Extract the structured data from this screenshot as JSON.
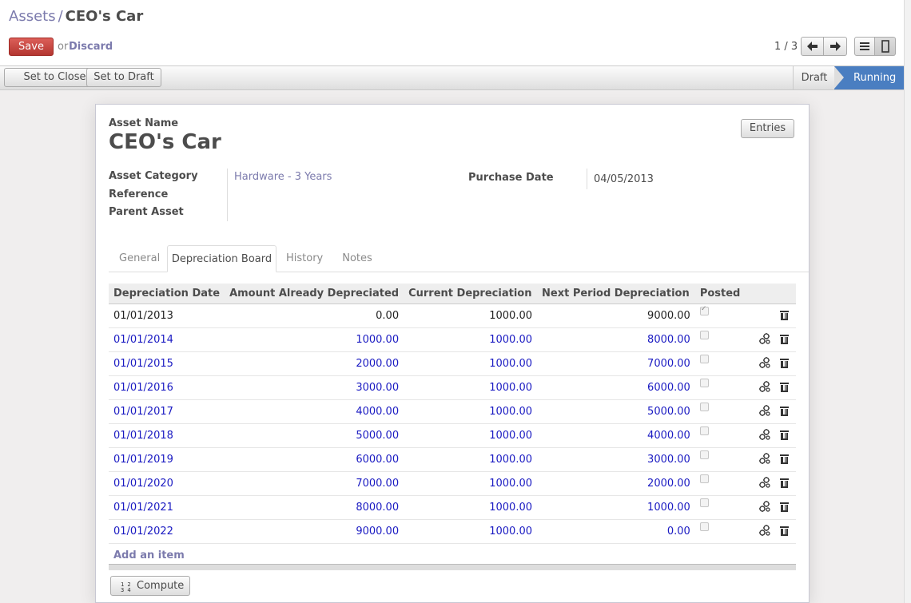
{
  "breadcrumb": {
    "parent": "Assets",
    "separator": "/",
    "current": "CEO's Car"
  },
  "actions": {
    "save": "Save",
    "or": "or",
    "discard": "Discard"
  },
  "pager": {
    "text": "1 / 3",
    "prev_icon": "arrow-left-icon",
    "next_icon": "arrow-right-icon"
  },
  "views": {
    "list_icon": "list-view-icon",
    "form_icon": "form-view-icon",
    "active": "form"
  },
  "statusbar": {
    "buttons": [
      "Set to Close",
      "Set to Draft"
    ],
    "stages": [
      "Draft",
      "Running"
    ],
    "current_stage": "Running"
  },
  "form": {
    "asset_name_label": "Asset Name",
    "asset_name": "CEO's Car",
    "entries_button": "Entries",
    "category_label": "Asset Category",
    "category_value": "Hardware - 3 Years",
    "reference_label": "Reference",
    "parent_label": "Parent Asset",
    "purchase_date_label": "Purchase Date",
    "purchase_date_value": "04/05/2013"
  },
  "tabs": [
    "General",
    "Depreciation Board",
    "History",
    "Notes"
  ],
  "active_tab": "Depreciation Board",
  "board": {
    "columns": [
      "Depreciation Date",
      "Amount Already Depreciated",
      "Current Depreciation",
      "Next Period Depreciation",
      "Posted"
    ],
    "rows": [
      {
        "date": "01/01/2013",
        "already": "0.00",
        "current": "1000.00",
        "next": "9000.00",
        "posted": true
      },
      {
        "date": "01/01/2014",
        "already": "1000.00",
        "current": "1000.00",
        "next": "8000.00",
        "posted": false
      },
      {
        "date": "01/01/2015",
        "already": "2000.00",
        "current": "1000.00",
        "next": "7000.00",
        "posted": false
      },
      {
        "date": "01/01/2016",
        "already": "3000.00",
        "current": "1000.00",
        "next": "6000.00",
        "posted": false
      },
      {
        "date": "01/01/2017",
        "already": "4000.00",
        "current": "1000.00",
        "next": "5000.00",
        "posted": false
      },
      {
        "date": "01/01/2018",
        "already": "5000.00",
        "current": "1000.00",
        "next": "4000.00",
        "posted": false
      },
      {
        "date": "01/01/2019",
        "already": "6000.00",
        "current": "1000.00",
        "next": "3000.00",
        "posted": false
      },
      {
        "date": "01/01/2020",
        "already": "7000.00",
        "current": "1000.00",
        "next": "2000.00",
        "posted": false
      },
      {
        "date": "01/01/2021",
        "already": "8000.00",
        "current": "1000.00",
        "next": "1000.00",
        "posted": false
      },
      {
        "date": "01/01/2022",
        "already": "9000.00",
        "current": "1000.00",
        "next": "0.00",
        "posted": false
      }
    ],
    "add_item": "Add an item",
    "compute_button": "Compute"
  }
}
